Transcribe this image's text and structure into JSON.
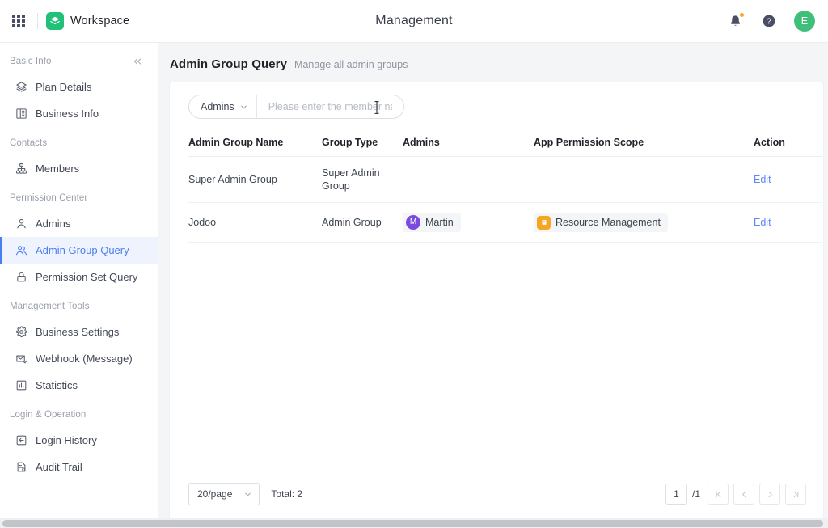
{
  "topbar": {
    "apps_icon": "grid-apps-icon",
    "brand_logo_icon": "layers-logo-icon",
    "brand_name": "Workspace",
    "page_title": "Management",
    "notification_icon": "bell-icon",
    "help_icon": "question-circle-icon",
    "avatar_initial": "E",
    "avatar_color": "#3fbf79",
    "brand_color": "#21c17a"
  },
  "sidebar": {
    "collapse_icon": "double-chevron-left-icon",
    "groups": [
      {
        "label": "Basic Info",
        "items": [
          {
            "label": "Plan Details",
            "icon": "layers-icon",
            "active": false
          },
          {
            "label": "Business Info",
            "icon": "building-icon",
            "active": false
          }
        ]
      },
      {
        "label": "Contacts",
        "items": [
          {
            "label": "Members",
            "icon": "org-tree-icon",
            "active": false
          }
        ]
      },
      {
        "label": "Permission Center",
        "items": [
          {
            "label": "Admins",
            "icon": "user-icon",
            "active": false
          },
          {
            "label": "Admin Group Query",
            "icon": "users-group-icon",
            "active": true
          },
          {
            "label": "Permission Set Query",
            "icon": "lock-icon",
            "active": false
          }
        ]
      },
      {
        "label": "Management Tools",
        "items": [
          {
            "label": "Business Settings",
            "icon": "gear-icon",
            "active": false
          },
          {
            "label": "Webhook (Message)",
            "icon": "mail-check-icon",
            "active": false
          },
          {
            "label": "Statistics",
            "icon": "bar-chart-icon",
            "active": false
          }
        ]
      },
      {
        "label": "Login & Operation",
        "items": [
          {
            "label": "Login History",
            "icon": "login-arrow-icon",
            "active": false
          },
          {
            "label": "Audit Trail",
            "icon": "audit-document-icon",
            "active": false
          }
        ]
      }
    ],
    "active_color": "#4a7ef0",
    "active_bg": "#eef3fe"
  },
  "page": {
    "title": "Admin Group Query",
    "subtitle": "Manage all admin groups"
  },
  "search": {
    "select_value": "Admins",
    "select_chevron_icon": "chevron-down-icon",
    "placeholder": "Please enter the member na...",
    "value": ""
  },
  "table": {
    "columns": [
      "Admin Group Name",
      "Group Type",
      "Admins",
      "App Permission Scope",
      "Action"
    ],
    "rows": [
      {
        "name": "Super Admin Group",
        "type": "Super Admin Group",
        "admins": [],
        "scope": [],
        "action": "Edit"
      },
      {
        "name": "Jodoo",
        "type": "Admin Group",
        "admins": [
          {
            "name": "Martin",
            "initial": "M",
            "avatar_color": "#7b4ae0"
          }
        ],
        "scope": [
          {
            "name": "Resource Management",
            "icon_color": "#f5a623",
            "icon": "app-square-icon"
          }
        ],
        "action": "Edit"
      }
    ],
    "action_link_color": "#5f88f5"
  },
  "pagination": {
    "page_size": "20/page",
    "page_size_chevron_icon": "chevron-down-icon",
    "total_text": "Total: 2",
    "current_page": "1",
    "total_pages": "/1",
    "first_icon": "page-first-icon",
    "prev_icon": "chevron-left-icon",
    "next_icon": "chevron-right-icon",
    "last_icon": "page-last-icon"
  }
}
